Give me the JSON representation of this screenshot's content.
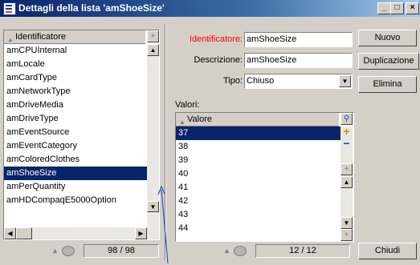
{
  "window": {
    "title": "Dettagli della lista 'amShoeSize'",
    "controls": [
      "_",
      "□",
      "×"
    ]
  },
  "left_list": {
    "column_header": "Identificatore",
    "items": [
      "amCPUInternal",
      "amLocale",
      "amCardType",
      "amNetworkType",
      "amDriveMedia",
      "amDriveType",
      "amEventSource",
      "amEventCategory",
      "amColoredClothes",
      "amShoeSize",
      "amPerQuantity",
      "amHDCompaqE5000Option"
    ],
    "selected_index": 9,
    "counter": "98 / 98"
  },
  "form": {
    "identifier_label": "Identificatore:",
    "identifier_value": "amShoeSize",
    "description_label": "Descrizione:",
    "description_value": "amShoeSize",
    "type_label": "Tipo:",
    "type_value": "Chiuso",
    "values_label": "Valori:"
  },
  "values_list": {
    "column_header": "Valore",
    "items": [
      "37",
      "38",
      "39",
      "40",
      "41",
      "42",
      "43",
      "44"
    ],
    "selected_index": 0,
    "counter": "12 / 12"
  },
  "buttons": {
    "new": "Nuovo",
    "duplicate": "Duplicazione",
    "delete": "Elimina",
    "close": "Chiudi"
  },
  "colors": {
    "title_start": "#0a246a",
    "selection": "#0a246a",
    "required_label": "#ff0000",
    "plus": "#e08000",
    "minus": "#2040c0"
  }
}
